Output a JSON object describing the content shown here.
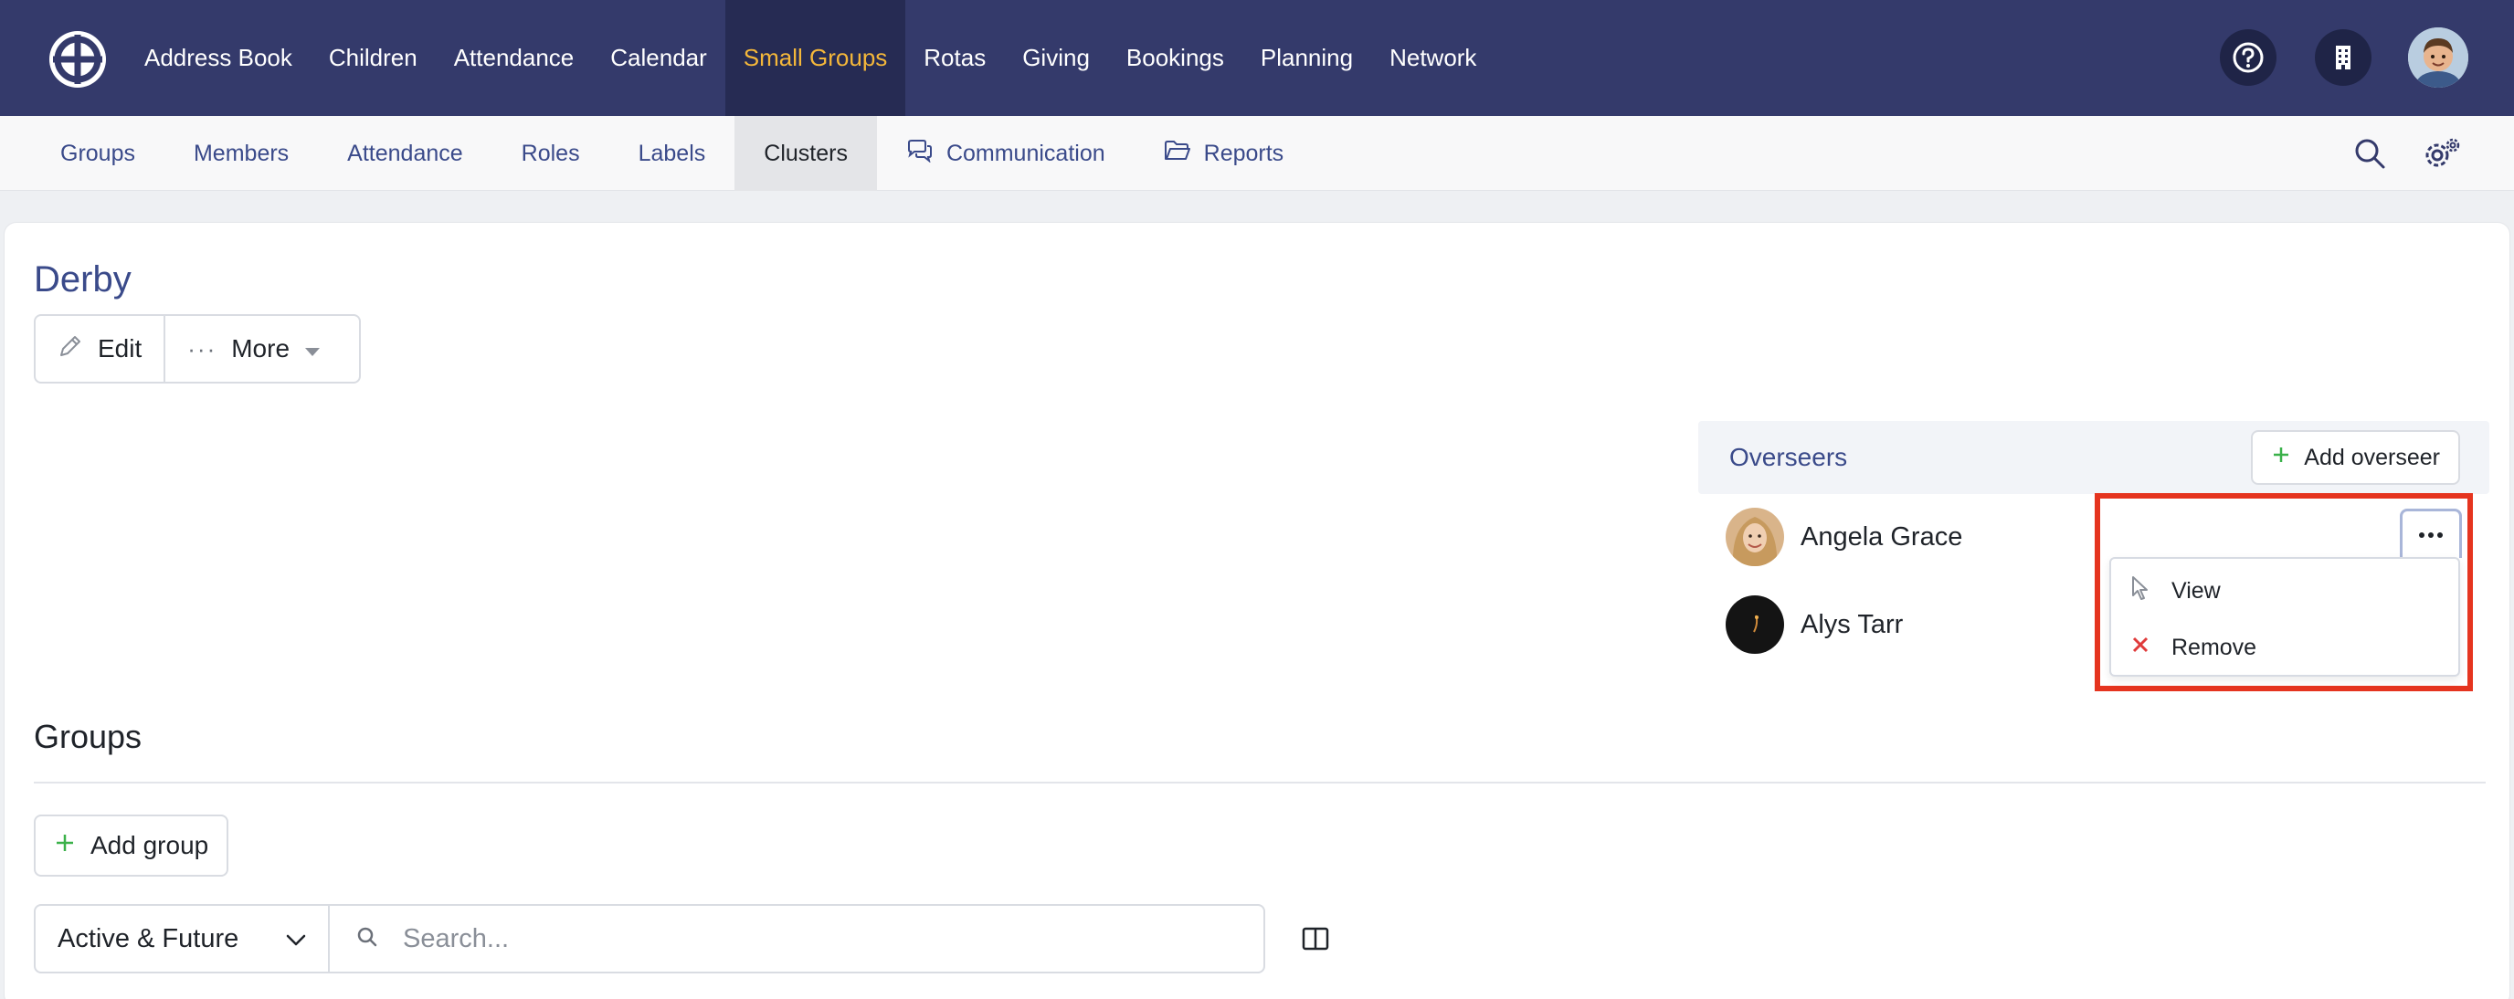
{
  "topnav": {
    "items": [
      {
        "label": "Address Book"
      },
      {
        "label": "Children"
      },
      {
        "label": "Attendance"
      },
      {
        "label": "Calendar"
      },
      {
        "label": "Small Groups",
        "active": true
      },
      {
        "label": "Rotas"
      },
      {
        "label": "Giving"
      },
      {
        "label": "Bookings"
      },
      {
        "label": "Planning"
      },
      {
        "label": "Network"
      }
    ],
    "icons": [
      "logo-icon",
      "help-icon",
      "building-icon",
      "user-avatar"
    ]
  },
  "subnav": {
    "items": [
      {
        "label": "Groups"
      },
      {
        "label": "Members"
      },
      {
        "label": "Attendance"
      },
      {
        "label": "Roles"
      },
      {
        "label": "Labels"
      },
      {
        "label": "Clusters",
        "active": true
      },
      {
        "label": "Communication",
        "icon": "chat-icon"
      },
      {
        "label": "Reports",
        "icon": "folder-icon"
      }
    ],
    "icons": [
      "search-icon",
      "settings-icon"
    ]
  },
  "page": {
    "title": "Derby",
    "edit_label": "Edit",
    "more_label": "More"
  },
  "overseers": {
    "title": "Overseers",
    "add_label": "Add overseer",
    "people": [
      {
        "name": "Angela Grace"
      },
      {
        "name": "Alys Tarr"
      }
    ],
    "menu": {
      "view_label": "View",
      "remove_label": "Remove"
    }
  },
  "groups": {
    "title": "Groups",
    "add_label": "Add group",
    "filter_value": "Active & Future",
    "search_placeholder": "Search..."
  },
  "colors": {
    "nav_bg": "#343a6b",
    "nav_active_bg": "#262b53",
    "nav_active_text": "#f4b73a",
    "link_blue": "#3a4a8a",
    "add_green": "#3bb14a",
    "highlight_red": "#e5341f",
    "remove_red": "#e03b3b"
  }
}
